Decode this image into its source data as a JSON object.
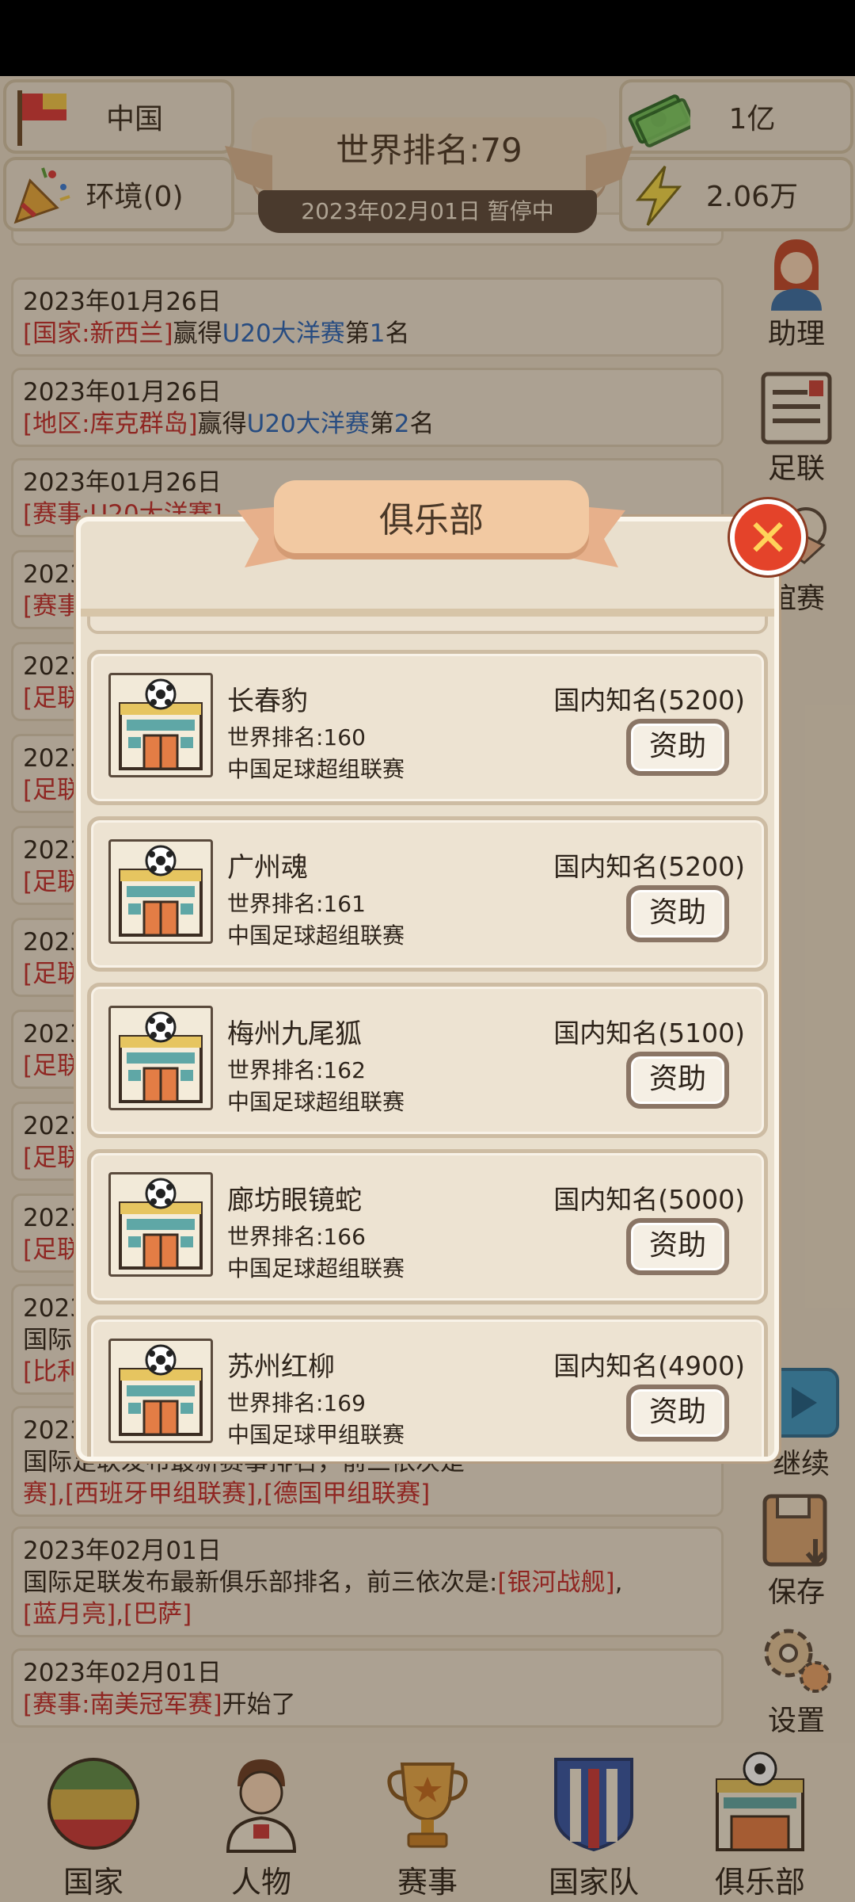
{
  "hud": {
    "country": "中国",
    "environment": "环境(0)",
    "money": "1亿",
    "energy": "2.06万",
    "world_rank": "世界排名:79",
    "date_status": "2023年02月01日  暂停中"
  },
  "log": [
    {
      "date": "2023年01月26日",
      "l1a": "[国家:新西兰]",
      "l1b": "赢得",
      "l1c": "U20大洋赛",
      "l1d": "第",
      "l1e": "1",
      "l1f": "名"
    },
    {
      "date": "2023年01月26日",
      "l1a": "[地区:库克群岛]",
      "l1b": "赢得",
      "l1c": "U20大洋赛",
      "l1d": "第",
      "l1e": "2",
      "l1f": "名"
    },
    {
      "date": "2023年01月26日",
      "l1a": "[赛事:U20大洋赛]"
    },
    {
      "date": "2023",
      "l1a": "[赛事"
    },
    {
      "date": "2023",
      "l1a": "[足联"
    },
    {
      "date": "2023",
      "l1a": "[足联"
    },
    {
      "date": "2023",
      "l1a": "[足联"
    },
    {
      "date": "2023",
      "l1a": "[足联"
    },
    {
      "date": "2023",
      "l1a": "[足联"
    },
    {
      "date": "2023",
      "l1a": "[足联"
    },
    {
      "date": "2023",
      "l1a": "[足联"
    },
    {
      "date": "2023",
      "l1b": "国际",
      "l2": "[比利"
    },
    {
      "date": "2023",
      "l1b": "国际足联发布最新赛事排名，前三依次是",
      "l2": "赛],[西班牙甲组联赛],[德国甲组联赛]"
    },
    {
      "date": "2023年02月01日",
      "l1b": "国际足联发布最新俱乐部排名，前三依次是:",
      "l1c": "[银河战舰]",
      "l1d": ",",
      "l2": "[蓝月亮],[巴萨]"
    },
    {
      "date": "2023年02月01日",
      "l1a": "[赛事:南美冠军赛]",
      "l1b": "开始了"
    }
  ],
  "side_menu": {
    "assistant": "助理",
    "federation": "足联",
    "friendly": "谊赛",
    "continue": "继续",
    "save": "保存",
    "settings": "设置"
  },
  "nav": {
    "country": "国家",
    "people": "人物",
    "events": "赛事",
    "national_team": "国家队",
    "club": "俱乐部"
  },
  "modal": {
    "title": "俱乐部",
    "fund_label": "资助",
    "clubs": [
      {
        "name": "长春豹",
        "rank": "世界排名:160",
        "league": "中国足球超组联赛",
        "fame": "国内知名(5200)"
      },
      {
        "name": "广州魂",
        "rank": "世界排名:161",
        "league": "中国足球超组联赛",
        "fame": "国内知名(5200)"
      },
      {
        "name": "梅州九尾狐",
        "rank": "世界排名:162",
        "league": "中国足球超组联赛",
        "fame": "国内知名(5100)"
      },
      {
        "name": "廊坊眼镜蛇",
        "rank": "世界排名:166",
        "league": "中国足球超组联赛",
        "fame": "国内知名(5000)"
      },
      {
        "name": "苏州红柳",
        "rank": "世界排名:169",
        "league": "中国足球甲组联赛",
        "fame": "国内知名(4900)"
      }
    ]
  },
  "colors": {
    "event_red": "#c22c2c",
    "event_blue": "#2764b9",
    "panel_bg": "#e9dfcd",
    "close_red": "#e4432a"
  }
}
